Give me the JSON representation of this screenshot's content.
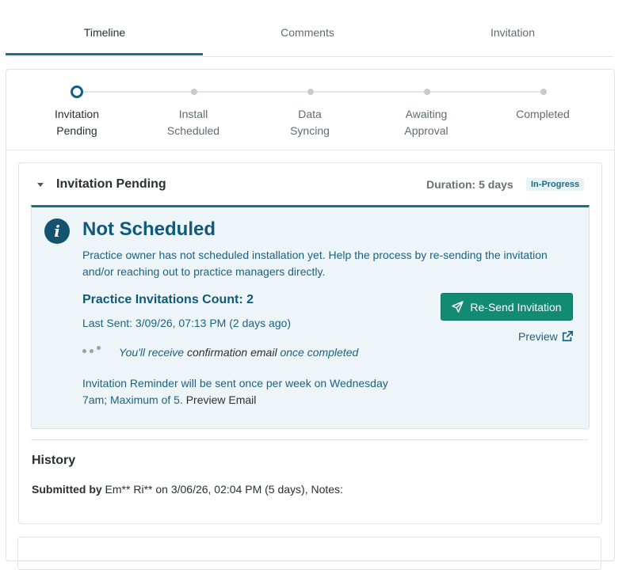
{
  "tabs": [
    {
      "label": "Timeline",
      "active": true
    },
    {
      "label": "Comments",
      "active": false
    },
    {
      "label": "Invitation",
      "active": false
    }
  ],
  "stepper": {
    "steps": [
      {
        "line1": "Invitation",
        "line2": "Pending",
        "active": true
      },
      {
        "line1": "Install",
        "line2": "Scheduled",
        "active": false
      },
      {
        "line1": "Data",
        "line2": "Syncing",
        "active": false
      },
      {
        "line1": "Awaiting",
        "line2": "Approval",
        "active": false
      },
      {
        "line1": "Completed",
        "line2": "",
        "active": false
      }
    ]
  },
  "stage": {
    "title": "Invitation Pending",
    "duration": "Duration: 5 days",
    "status": "In-Progress"
  },
  "alert": {
    "icon": "info-icon",
    "icon_glyph": "i",
    "title": "Not Scheduled",
    "description": "Practice owner has not scheduled installation yet. Help the process by re-sending the invitation and/or reaching out to practice managers directly.",
    "count": "Practice Invitations Count: 2",
    "last_sent": "Last Sent: 3/09/26, 07:13 PM (2 days ago)",
    "confirm_a": "You'll receive",
    "confirm_b": " confirmation email ",
    "confirm_c": "once completed",
    "reminder": "Invitation Reminder will be sent once per week on Wednesday 7am; Maximum of 5. ",
    "reminder_link": "Preview Email",
    "resend_label": "Re-Send Invitation",
    "preview_label": "Preview"
  },
  "history": {
    "title": "History",
    "submitted_label": "Submitted by",
    "submitted_text": " Em** Ri** on 3/06/26, 02:04 PM (5 days), Notes:"
  },
  "colors": {
    "accent": "#1b6f95",
    "primary_button": "#138b73",
    "alert_bg": "#eef5f8",
    "alert_text": "#1b6284"
  }
}
